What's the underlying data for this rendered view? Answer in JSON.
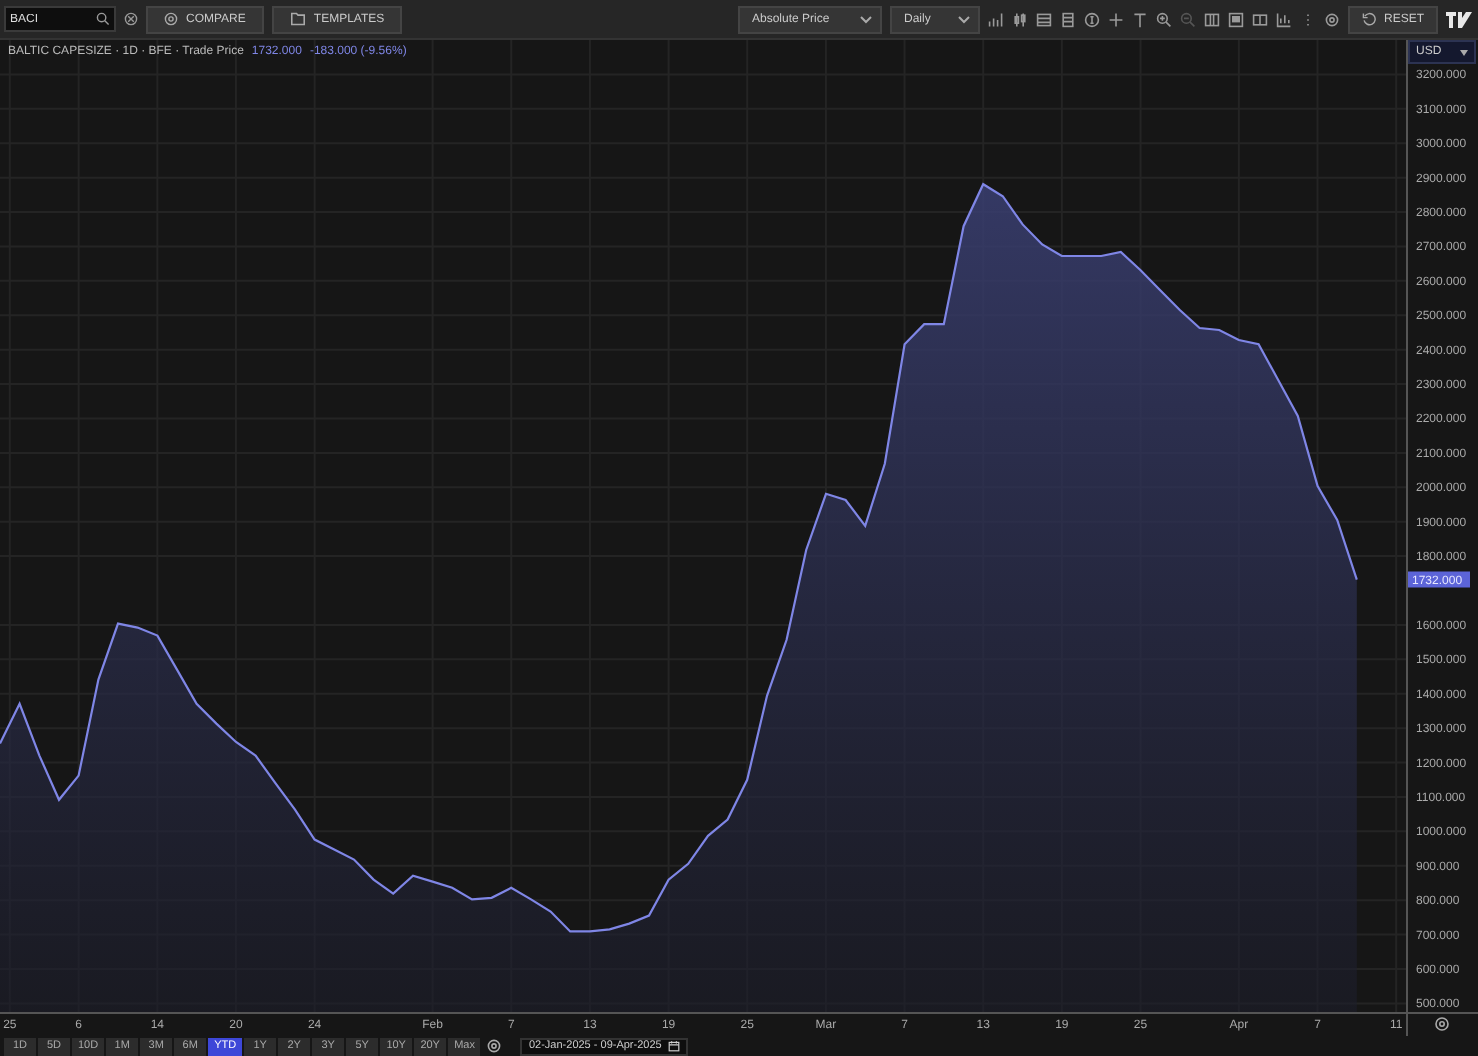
{
  "toolbar": {
    "search": {
      "value": "BACI"
    },
    "compare_button": "COMPARE",
    "templates_button": "TEMPLATES",
    "price_mode": "Absolute Price",
    "interval": "Daily",
    "reset_button": "RESET"
  },
  "legend": {
    "title": "BALTIC CAPESIZE · 1D · BFE · Trade Price",
    "price": "1732.000",
    "change": "-183.000 (-9.56%)"
  },
  "currency": "USD",
  "price_tag": "1732.000",
  "chart_data": {
    "type": "area",
    "grid": true,
    "categories": [
      null,
      null,
      null,
      null,
      null,
      null,
      null,
      null,
      null,
      null,
      null,
      null,
      null,
      null,
      null,
      null,
      null,
      null,
      null,
      null,
      null,
      null,
      null,
      null,
      null,
      null,
      null,
      null,
      null,
      null,
      null,
      null,
      null,
      null,
      null,
      null,
      null,
      null,
      null,
      null,
      null,
      null,
      null,
      null,
      null,
      null,
      null,
      null,
      null,
      null,
      null,
      null,
      null,
      null,
      null,
      null,
      null,
      null,
      null,
      null,
      null,
      null,
      null,
      null,
      null,
      null,
      null,
      null,
      null,
      null
    ],
    "series": [
      {
        "color": "#7f86e6",
        "values": [
          1255,
          1371,
          1220,
          1092,
          1162,
          1441,
          1604,
          1592,
          1569,
          1470,
          1371,
          1313,
          1260,
          1220,
          1140,
          1063,
          976,
          947,
          918,
          860,
          819,
          871,
          854,
          836,
          802,
          807,
          836,
          802,
          767,
          709,
          709,
          715,
          732,
          755,
          860,
          906,
          987,
          1034,
          1150,
          1394,
          1557,
          1818,
          1981,
          1963,
          1888,
          2068,
          2416,
          2474,
          2474,
          2759,
          2881,
          2846,
          2764,
          2706,
          2672,
          2672,
          2672,
          2684,
          2631,
          2573,
          2515,
          2463,
          2457,
          2428,
          2416,
          2312,
          2207,
          2004,
          1905,
          1732
        ]
      }
    ],
    "ylim": [
      475,
      3300
    ],
    "yticks": [
      {
        "value": 500,
        "label": "500.000"
      },
      {
        "value": 600,
        "label": "600.000"
      },
      {
        "value": 700,
        "label": "700.000"
      },
      {
        "value": 800,
        "label": "800.000"
      },
      {
        "value": 900,
        "label": "900.000"
      },
      {
        "value": 1000,
        "label": "1000.000"
      },
      {
        "value": 1100,
        "label": "1100.000"
      },
      {
        "value": 1200,
        "label": "1200.000"
      },
      {
        "value": 1300,
        "label": "1300.000"
      },
      {
        "value": 1400,
        "label": "1400.000"
      },
      {
        "value": 1500,
        "label": "1500.000"
      },
      {
        "value": 1600,
        "label": "1600.000"
      },
      {
        "value": 1800,
        "label": "1800.000"
      },
      {
        "value": 1900,
        "label": "1900.000"
      },
      {
        "value": 2000,
        "label": "2000.000"
      },
      {
        "value": 2100,
        "label": "2100.000"
      },
      {
        "value": 2200,
        "label": "2200.000"
      },
      {
        "value": 2300,
        "label": "2300.000"
      },
      {
        "value": 2400,
        "label": "2400.000"
      },
      {
        "value": 2500,
        "label": "2500.000"
      },
      {
        "value": 2600,
        "label": "2600.000"
      },
      {
        "value": 2700,
        "label": "2700.000"
      },
      {
        "value": 2800,
        "label": "2800.000"
      },
      {
        "value": 2900,
        "label": "2900.000"
      },
      {
        "value": 3000,
        "label": "3000.000"
      },
      {
        "value": 3100,
        "label": "3100.000"
      },
      {
        "value": 3200,
        "label": "3200.000"
      }
    ]
  },
  "date_axis": [
    "25",
    "6",
    "14",
    "20",
    "24",
    "Feb",
    "7",
    "13",
    "19",
    "25",
    "Mar",
    "7",
    "13",
    "19",
    "25",
    "Apr",
    "7",
    "11"
  ],
  "range_bar": {
    "ranges": [
      {
        "label": "1D",
        "selected": false
      },
      {
        "label": "5D",
        "selected": false
      },
      {
        "label": "10D",
        "selected": false
      },
      {
        "label": "1M",
        "selected": false
      },
      {
        "label": "3M",
        "selected": false
      },
      {
        "label": "6M",
        "selected": false
      },
      {
        "label": "YTD",
        "selected": true
      },
      {
        "label": "1Y",
        "selected": false
      },
      {
        "label": "2Y",
        "selected": false
      },
      {
        "label": "3Y",
        "selected": false
      },
      {
        "label": "5Y",
        "selected": false
      },
      {
        "label": "10Y",
        "selected": false
      },
      {
        "label": "20Y",
        "selected": false
      },
      {
        "label": "Max",
        "selected": false
      }
    ],
    "date_range": "02-Jan-2025 - 09-Apr-2025"
  }
}
